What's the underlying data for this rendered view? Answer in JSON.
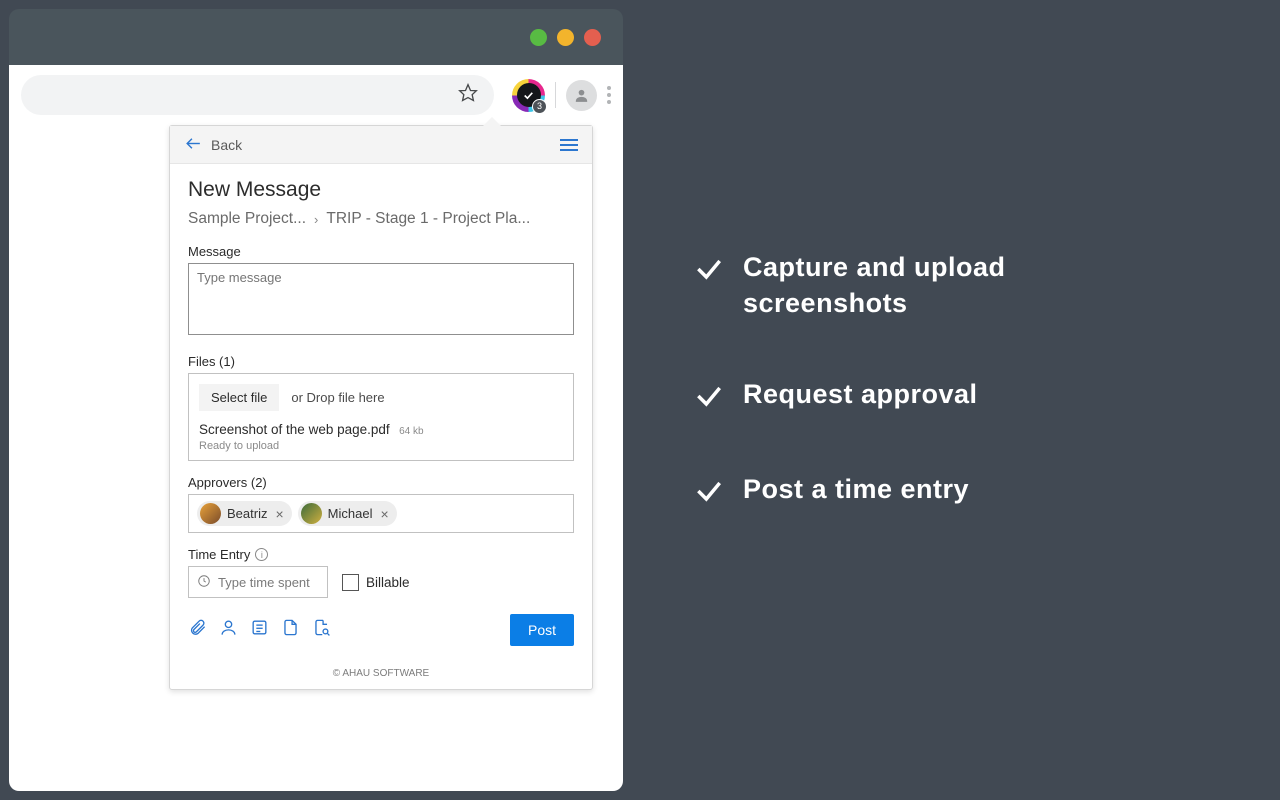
{
  "browser": {
    "traffic": {
      "green": "#58bb43",
      "yellow": "#f3b42c",
      "red": "#e45f4f"
    },
    "badge_count": "3"
  },
  "popup": {
    "back_label": "Back",
    "title": "New Message",
    "breadcrumb": {
      "project": "Sample Project...",
      "item": "TRIP - Stage 1 - Project Pla..."
    },
    "message": {
      "label": "Message",
      "placeholder": "Type message"
    },
    "files": {
      "label": "Files (1)",
      "select_btn": "Select file",
      "drop_hint": "or Drop file here",
      "file_name": "Screenshot of the web page.pdf",
      "file_size": "64 kb",
      "status": "Ready to upload"
    },
    "approvers": {
      "label": "Approvers (2)",
      "items": [
        {
          "name": "Beatriz",
          "color1": "#e9a23a",
          "color2": "#7a4c2a"
        },
        {
          "name": "Michael",
          "color1": "#3c6b3a",
          "color2": "#d0b040"
        }
      ]
    },
    "time": {
      "label": "Time Entry",
      "placeholder": "Type time spent",
      "billable_label": "Billable"
    },
    "post_label": "Post",
    "footer": "© AHAU SOFTWARE"
  },
  "features": [
    "Capture and upload screenshots",
    "Request approval",
    "Post a time entry"
  ]
}
